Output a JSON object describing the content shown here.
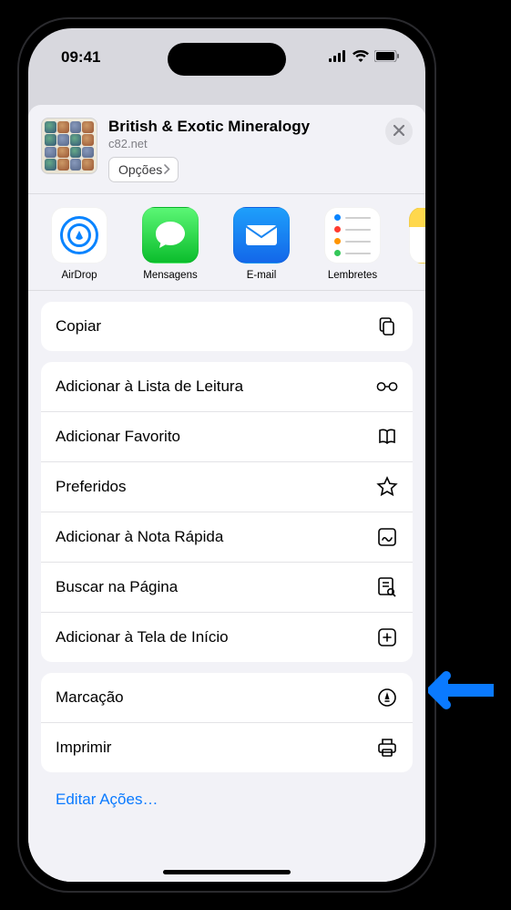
{
  "status": {
    "time": "09:41"
  },
  "header": {
    "title": "British & Exotic Mineralogy",
    "domain": "c82.net",
    "options_label": "Opções"
  },
  "apps": [
    {
      "name": "airdrop",
      "label": "AirDrop"
    },
    {
      "name": "messages",
      "label": "Mensagens"
    },
    {
      "name": "mail",
      "label": "E-mail"
    },
    {
      "name": "reminders",
      "label": "Lembretes"
    },
    {
      "name": "notes",
      "label": ""
    }
  ],
  "actions": {
    "copy": "Copiar",
    "reading_list": "Adicionar à Lista de Leitura",
    "bookmark": "Adicionar Favorito",
    "favorites": "Preferidos",
    "quick_note": "Adicionar à Nota Rápida",
    "find": "Buscar na Página",
    "home_screen": "Adicionar à Tela de Início",
    "markup": "Marcação",
    "print": "Imprimir"
  },
  "footer": {
    "edit_actions": "Editar Ações…"
  }
}
